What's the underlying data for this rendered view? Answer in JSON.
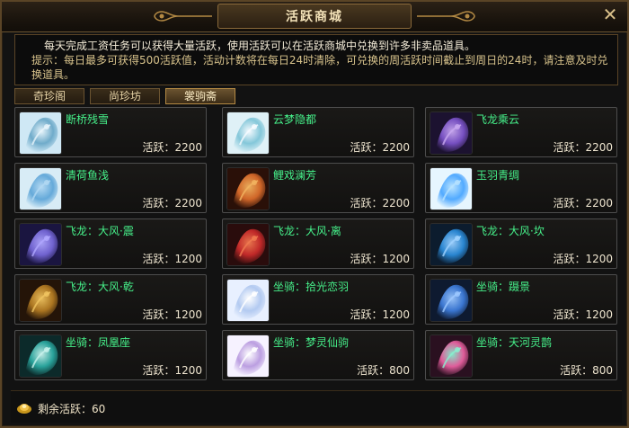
{
  "window": {
    "title": "活跃商城",
    "close_glyph": "✕"
  },
  "info": {
    "line1": "每天完成工资任务可以获得大量活跃，使用活跃可以在活跃商城中兑换到许多非卖品道具。",
    "line2": "提示：每日最多可获得500活跃值，活动计数将在每日24时清除，可兑换的周活跃时间截止到周日的24时，请注意及时兑换道具。"
  },
  "tabs": [
    {
      "label": "奇珍阁",
      "active": false
    },
    {
      "label": "尚珍坊",
      "active": false
    },
    {
      "label": "裳驹斋",
      "active": true
    }
  ],
  "items": [
    {
      "name": "断桥残雪",
      "price": "活跃：2200",
      "icon": "white-wing-outfit-icon",
      "colors": [
        "#cfe8f5",
        "#6aa8c8",
        "#e8f5fb"
      ]
    },
    {
      "name": "云梦隐都",
      "price": "活跃：2200",
      "icon": "blue-white-robe-icon",
      "colors": [
        "#dff1f7",
        "#7fc5d8",
        "#f7fbff"
      ]
    },
    {
      "name": "飞龙乘云",
      "price": "活跃：2200",
      "icon": "purple-dragon-mount-icon",
      "colors": [
        "#1c1230",
        "#7a52c8",
        "#c8a8f0"
      ]
    },
    {
      "name": "清荷鱼浅",
      "price": "活跃：2200",
      "icon": "blue-lotus-outfit-icon",
      "colors": [
        "#d8ecf6",
        "#5fa6d8",
        "#b2d8f2"
      ]
    },
    {
      "name": "鲤戏澜芳",
      "price": "活跃：2200",
      "icon": "red-carp-outfit-icon",
      "colors": [
        "#2a1008",
        "#d86a2a",
        "#f2b460"
      ]
    },
    {
      "name": "玉羽青绸",
      "price": "活跃：2200",
      "icon": "jade-feather-outfit-icon",
      "colors": [
        "#e6f6ff",
        "#4aa6ff",
        "#b6e2ff"
      ]
    },
    {
      "name": "飞龙：大风·震",
      "price": "活跃：1200",
      "icon": "purple-dragon-head-icon",
      "colors": [
        "#1a1540",
        "#7466d6",
        "#b0a8ff"
      ]
    },
    {
      "name": "飞龙：大风·离",
      "price": "活跃：1200",
      "icon": "red-dragon-head-icon",
      "colors": [
        "#2a0c0c",
        "#c82a2a",
        "#f07a50"
      ]
    },
    {
      "name": "飞龙：大风·坎",
      "price": "活跃：1200",
      "icon": "blue-dragon-head-icon",
      "colors": [
        "#0c1c2e",
        "#2a8ad8",
        "#9fd2ff"
      ]
    },
    {
      "name": "飞龙：大风·乾",
      "price": "活跃：1200",
      "icon": "gold-dragon-head-icon",
      "colors": [
        "#241408",
        "#b27a22",
        "#f0c460"
      ]
    },
    {
      "name": "坐骑：拾光恋羽",
      "price": "活跃：1200",
      "icon": "white-feather-mount-icon",
      "colors": [
        "#e8f0ff",
        "#b0c8f0",
        "#ffffff"
      ]
    },
    {
      "name": "坐骑：蹑景",
      "price": "活跃：1200",
      "icon": "blue-horse-mount-icon",
      "colors": [
        "#0e1a30",
        "#3c7ad8",
        "#9cc8ff"
      ]
    },
    {
      "name": "坐骑：凤凰座",
      "price": "活跃：1200",
      "icon": "teal-phoenix-mount-icon",
      "colors": [
        "#0c2a2a",
        "#2aa8a0",
        "#c8f2ec"
      ]
    },
    {
      "name": "坐骑：梦灵仙驹",
      "price": "活跃：800",
      "icon": "white-unicorn-mount-icon",
      "colors": [
        "#f6f2ff",
        "#b89adf",
        "#ffffff"
      ]
    },
    {
      "name": "坐骑：天河灵鹊",
      "price": "活跃：800",
      "icon": "pink-magpie-mount-icon",
      "colors": [
        "#2a1020",
        "#e860a0",
        "#8af0d0"
      ]
    }
  ],
  "footer": {
    "remaining": "剩余活跃：60",
    "coin_icon": "gold-ingot-icon"
  }
}
